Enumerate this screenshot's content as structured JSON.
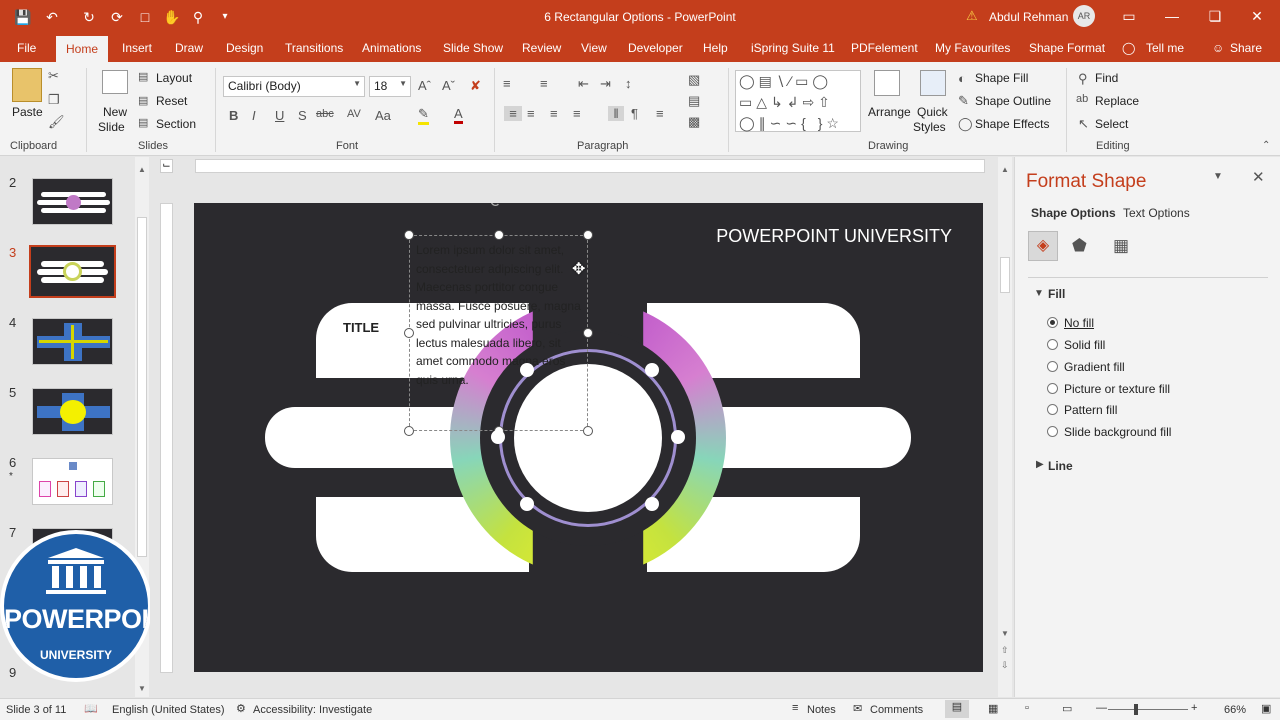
{
  "window": {
    "title": "6 Rectangular Options  -  PowerPoint",
    "user_name": "Abdul Rehman",
    "user_initials": "AR",
    "tell_me": "Tell me",
    "share": "Share"
  },
  "tabs": [
    "File",
    "Home",
    "Insert",
    "Draw",
    "Design",
    "Transitions",
    "Animations",
    "Slide Show",
    "Review",
    "View",
    "Developer",
    "Help",
    "iSpring Suite 11",
    "PDFelement",
    "My Favourites",
    "Shape Format"
  ],
  "active_tab": "Home",
  "ribbon": {
    "clipboard": {
      "paste": "Paste",
      "label": "Clipboard"
    },
    "slides": {
      "new_slide": "New",
      "new_slide2": "Slide",
      "layout": "Layout",
      "reset": "Reset",
      "section": "Section",
      "label": "Slides"
    },
    "font": {
      "font_name": "Calibri (Body)",
      "font_size": "18",
      "label": "Font"
    },
    "paragraph": {
      "label": "Paragraph"
    },
    "drawing": {
      "arrange": "Arrange",
      "quick_styles": "Quick",
      "quick_styles2": "Styles",
      "shape_fill": "Shape Fill",
      "shape_outline": "Shape Outline",
      "shape_effects": "Shape Effects",
      "label": "Drawing"
    },
    "editing": {
      "find": "Find",
      "replace": "Replace",
      "select": "Select",
      "label": "Editing"
    }
  },
  "thumbnails": [
    {
      "num": "2",
      "star": ""
    },
    {
      "num": "3",
      "star": ""
    },
    {
      "num": "4",
      "star": ""
    },
    {
      "num": "5",
      "star": ""
    },
    {
      "num": "6",
      "star": "*"
    },
    {
      "num": "7",
      "star": ""
    },
    {
      "num": "9",
      "star": ""
    }
  ],
  "logo": {
    "text": "POWERPOINT",
    "sub": "UNIVERSITY"
  },
  "slide": {
    "heading": "POWERPOINT UNIVERSITY",
    "title_label": "TITLE",
    "lorem": "Lorem ipsum dolor sit amet, consectetuer adipiscing elit. Maecenas porttitor congue massa. Fusce posuere, magna sed pulvinar ultricies, purus lectus malesuada libero, sit amet commodo magna eros quis urna."
  },
  "format_pane": {
    "title": "Format Shape",
    "tab_shape": "Shape Options",
    "tab_text": "Text Options",
    "fill_section": "Fill",
    "fill_options": [
      "No fill",
      "Solid fill",
      "Gradient fill",
      "Picture or texture fill",
      "Pattern fill",
      "Slide background fill"
    ],
    "selected_fill": "No fill",
    "line_section": "Line"
  },
  "status": {
    "slide_of": "Slide 3 of 11",
    "language": "English (United States)",
    "accessibility": "Accessibility: Investigate",
    "notes": "Notes",
    "comments": "Comments",
    "zoom": "66%"
  },
  "colors": {
    "accent": "#c43e1c",
    "slide_bg": "#2b2a2e"
  }
}
